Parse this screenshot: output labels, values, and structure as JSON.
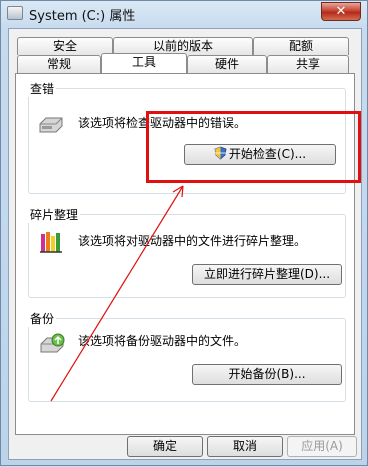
{
  "window": {
    "title": "System (C:) 属性",
    "close_label": "✕"
  },
  "tabs_top": [
    "安全",
    "以前的版本",
    "配额"
  ],
  "tabs_bottom": [
    "常规",
    "工具",
    "硬件",
    "共享"
  ],
  "groups": {
    "check": {
      "title": "查错",
      "text": "该选项将检查驱动器中的错误。",
      "button": "开始检查(C)..."
    },
    "defrag": {
      "title": "碎片整理",
      "text": "该选项将对驱动器中的文件进行碎片整理。",
      "button": "立即进行碎片整理(D)..."
    },
    "backup": {
      "title": "备份",
      "text": "该选项将备份驱动器中的文件。",
      "button": "开始备份(B)..."
    }
  },
  "footer": {
    "ok": "确定",
    "cancel": "取消",
    "apply": "应用(A)"
  },
  "annotation": {
    "color": "#e01010"
  }
}
